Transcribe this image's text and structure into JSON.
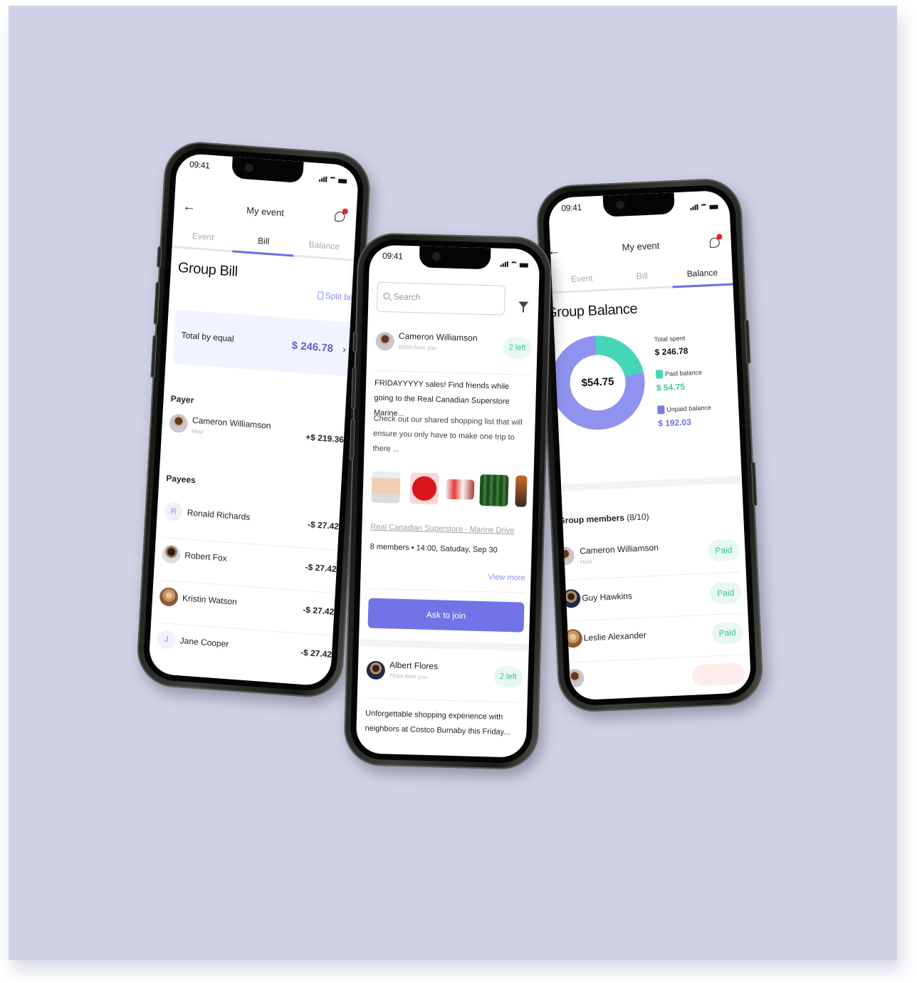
{
  "background_color": "#cfd2e4",
  "accent_color": "#6e6ee6",
  "paid_color": "#45d6b8",
  "unpaid_color": "#8f93ef",
  "status_bar": {
    "time": "09:41"
  },
  "left_phone": {
    "header": {
      "title": "My event"
    },
    "tabs": [
      {
        "label": "Event"
      },
      {
        "label": "Bill",
        "active": true
      },
      {
        "label": "Balance"
      }
    ],
    "page_title": "Group Bill",
    "split_bill_label": "Split bill",
    "total": {
      "label": "Total by equal",
      "value": "$ 246.78"
    },
    "payer_label": "Payer",
    "payer": {
      "name": "Cameron Williamson",
      "role": "Host",
      "amount": "+$ 219.36"
    },
    "payees_label": "Payees",
    "payees": [
      {
        "initial": "R",
        "name": "Ronald Richards",
        "amount": "-$ 27.42"
      },
      {
        "initial": "",
        "name": "Robert Fox",
        "amount": "-$ 27.42"
      },
      {
        "initial": "",
        "name": "Kristin Watson",
        "amount": "-$ 27.42"
      },
      {
        "initial": "J",
        "name": "Jane Cooper",
        "amount": "-$ 27.42"
      }
    ]
  },
  "middle_phone": {
    "search": {
      "placeholder": "Search"
    },
    "posts": [
      {
        "author": "Cameron Williamson",
        "distance": "900m from you",
        "spots": "2 left",
        "headline": "FRIDAYYYYY sales! Find friends while going to the Real Canadian Superstore Marine...",
        "description": "Check out our shared shopping list that will ensure you only have to make one trip to there ...",
        "products": [
          "chicken-breast",
          "cherry-tomatoes",
          "yogurt-pack",
          "cucumbers",
          "drink"
        ],
        "store": "Real Canadian Superstore - Marine Drive",
        "meta": "8 members • 14:00, Satuday, Sep 30",
        "view_more": "View more",
        "cta": "Ask to join"
      },
      {
        "author": "Albert Flores",
        "distance": "750m from you",
        "spots": "2 left",
        "headline": "Unforgettable shopping experience with neighbors at Costco Burnaby this Friday..."
      }
    ]
  },
  "right_phone": {
    "header": {
      "title": "My event"
    },
    "tabs": [
      {
        "label": "Event"
      },
      {
        "label": "Bill"
      },
      {
        "label": "Balance",
        "active": true
      }
    ],
    "page_title": "Group Balance",
    "donut_center": "$54.75",
    "total_spent": {
      "label": "Total spent",
      "value": "$ 246.78"
    },
    "paid": {
      "label": "Paid balance",
      "value": "$ 54.75",
      "amount": 54.75
    },
    "unpaid": {
      "label": "Unpaid balance",
      "value": "$ 192.03",
      "amount": 192.03
    },
    "members_label": "Group members",
    "members_count": "(8/10)",
    "members": [
      {
        "name": "Cameron Williamson",
        "role": "Host",
        "status": "Paid"
      },
      {
        "name": "Guy Hawkins",
        "status": "Paid"
      },
      {
        "name": "Leslie Alexander",
        "status": "Paid"
      }
    ]
  }
}
